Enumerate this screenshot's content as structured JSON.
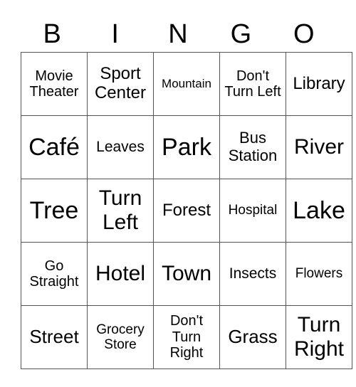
{
  "header": [
    "B",
    "I",
    "N",
    "G",
    "O"
  ],
  "rows": [
    [
      "Movie Theater",
      "Sport Center",
      "Mountain",
      "Don't Turn Left",
      "Library"
    ],
    [
      "Café",
      "Leaves",
      "Park",
      "Bus Station",
      "River"
    ],
    [
      "Tree",
      "Turn Left",
      "Forest",
      "Hospital",
      "Lake"
    ],
    [
      "Go Straight",
      "Hotel",
      "Town",
      "Insects",
      "Flowers"
    ],
    [
      "Street",
      "Grocery Store",
      "Don't Turn Right",
      "Grass",
      "Turn Right"
    ]
  ]
}
